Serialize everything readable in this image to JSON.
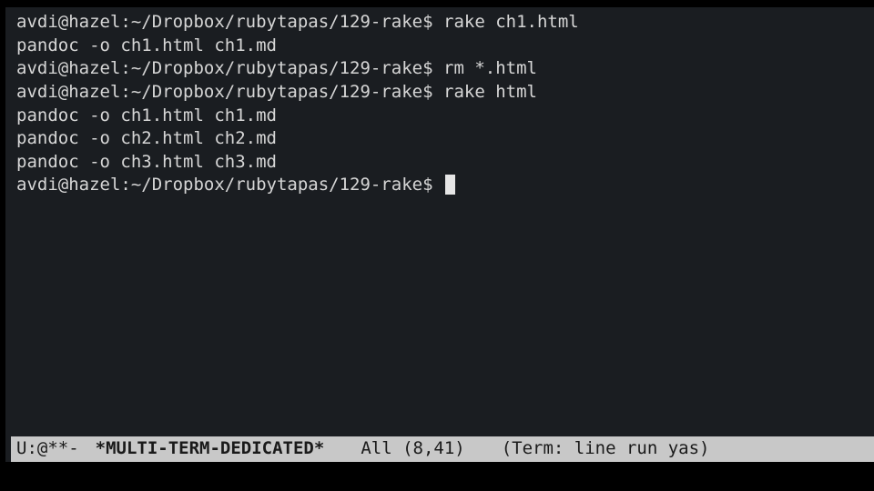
{
  "terminal": {
    "prompt": "avdi@hazel:~/Dropbox/rubytapas/129-rake$",
    "lines": [
      {
        "prompt": true,
        "cmd": "rake ch1.html"
      },
      {
        "prompt": false,
        "text": "pandoc -o ch1.html ch1.md"
      },
      {
        "prompt": true,
        "cmd": "rm *.html"
      },
      {
        "prompt": true,
        "cmd": "rake html"
      },
      {
        "prompt": false,
        "text": "pandoc -o ch1.html ch1.md"
      },
      {
        "prompt": false,
        "text": "pandoc -o ch2.html ch2.md"
      },
      {
        "prompt": false,
        "text": "pandoc -o ch3.html ch3.md"
      },
      {
        "prompt": true,
        "cmd": "",
        "cursor": true
      }
    ]
  },
  "status": {
    "left": "U:@**-",
    "buffer": "*MULTI-TERM-DEDICATED*",
    "position": "All (8,41)",
    "modes": "(Term: line run yas)"
  }
}
